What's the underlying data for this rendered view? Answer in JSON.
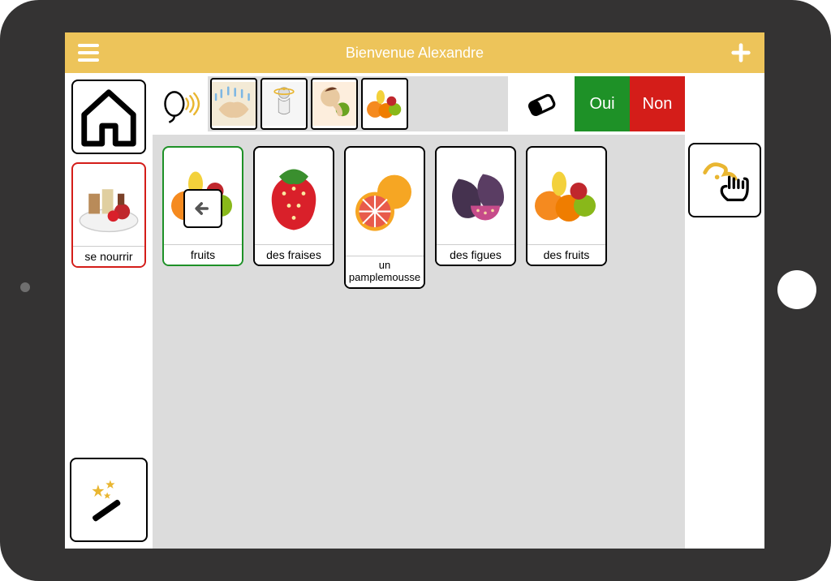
{
  "colors": {
    "accent": "#edc45a",
    "yes": "#1e9127",
    "no": "#d41d19"
  },
  "appbar": {
    "title": "Bienvenue Alexandre"
  },
  "buttons": {
    "yes": "Oui",
    "no": "Non"
  },
  "sidebar_parent": {
    "label": "se nourrir",
    "icon": "food-plate"
  },
  "sentence_strip": {
    "chips": [
      {
        "icon": "wash-hands"
      },
      {
        "icon": "want-figure"
      },
      {
        "icon": "eat-apple"
      },
      {
        "icon": "mixed-fruit"
      }
    ]
  },
  "grid": {
    "cards": [
      {
        "label": "fruits",
        "icon": "mixed-fruit",
        "border": "green",
        "back_overlay": true
      },
      {
        "label": "des fraises",
        "icon": "strawberry",
        "border": "black"
      },
      {
        "label": "un pamplemousse",
        "icon": "grapefruit",
        "border": "black",
        "tall": true
      },
      {
        "label": "des figues",
        "icon": "figs",
        "border": "black"
      },
      {
        "label": "des fruits",
        "icon": "mixed-fruit",
        "border": "black"
      }
    ]
  },
  "icons": {
    "home": "home-icon",
    "speak": "speak-icon",
    "eraser": "eraser-icon",
    "magic": "magic-wand-icon",
    "interact": "tap-hand-icon",
    "back": "arrow-left-icon",
    "menu": "hamburger-icon",
    "add": "plus-icon"
  }
}
